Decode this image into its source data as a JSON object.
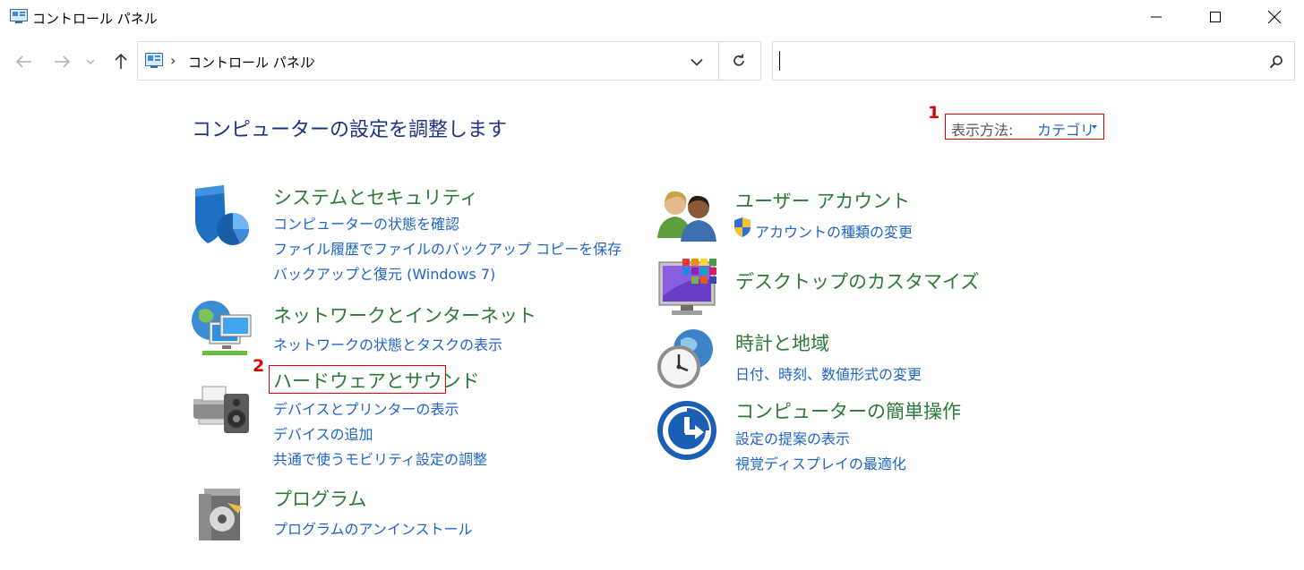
{
  "window": {
    "title": "コントロール パネル",
    "controls": [
      "minimize-icon",
      "maximize-icon",
      "close-icon"
    ]
  },
  "nav": {
    "back_icon": "back-arrow-icon",
    "forward_icon": "forward-arrow-icon",
    "recent_icon": "chevron-down-icon",
    "up_icon": "up-arrow-icon"
  },
  "address_bar": {
    "breadcrumb": "コントロール パネル",
    "separator": "›",
    "dropdown_icon": "chevron-down-icon",
    "refresh_icon": "refresh-icon"
  },
  "search": {
    "value": "",
    "placeholder": "",
    "icon": "search-icon"
  },
  "page": {
    "title": "コンピューターの設定を調整します",
    "view_by_label": "表示方法:",
    "view_by_value": "カテゴリ",
    "annotations": [
      "1",
      "2"
    ]
  },
  "categories": {
    "system": {
      "title": "システムとセキュリティ",
      "links": [
        "コンピューターの状態を確認",
        "ファイル履歴でファイルのバックアップ コピーを保存",
        "バックアップと復元 (Windows 7)"
      ],
      "icon": "shield-icon"
    },
    "network": {
      "title": "ネットワークとインターネット",
      "links": [
        "ネットワークの状態とタスクの表示"
      ],
      "icon": "network-globe-icon"
    },
    "hardware": {
      "title": "ハードウェアとサウンド",
      "links": [
        "デバイスとプリンターの表示",
        "デバイスの追加",
        "共通で使うモビリティ設定の調整"
      ],
      "icon": "printer-speaker-icon"
    },
    "programs": {
      "title": "プログラム",
      "links": [
        "プログラムのアンインストール"
      ],
      "icon": "programs-disc-icon"
    },
    "user": {
      "title": "ユーザー アカウント",
      "links": [
        "アカウントの種類の変更"
      ],
      "icon": "users-icon",
      "link_icon": "uac-shield-icon"
    },
    "desktop": {
      "title": "デスクトップのカスタマイズ",
      "links": [],
      "icon": "monitor-tiles-icon"
    },
    "clock": {
      "title": "時計と地域",
      "links": [
        "日付、時刻、数値形式の変更"
      ],
      "icon": "clock-globe-icon"
    },
    "access": {
      "title": "コンピューターの簡単操作",
      "links": [
        "設定の提案の表示",
        "視覚ディスプレイの最適化"
      ],
      "icon": "ease-of-access-icon"
    }
  },
  "colors": {
    "category_title": "#2a7a36",
    "link": "#1e64c8",
    "page_title": "#1e3287",
    "highlight": "#e00000"
  }
}
